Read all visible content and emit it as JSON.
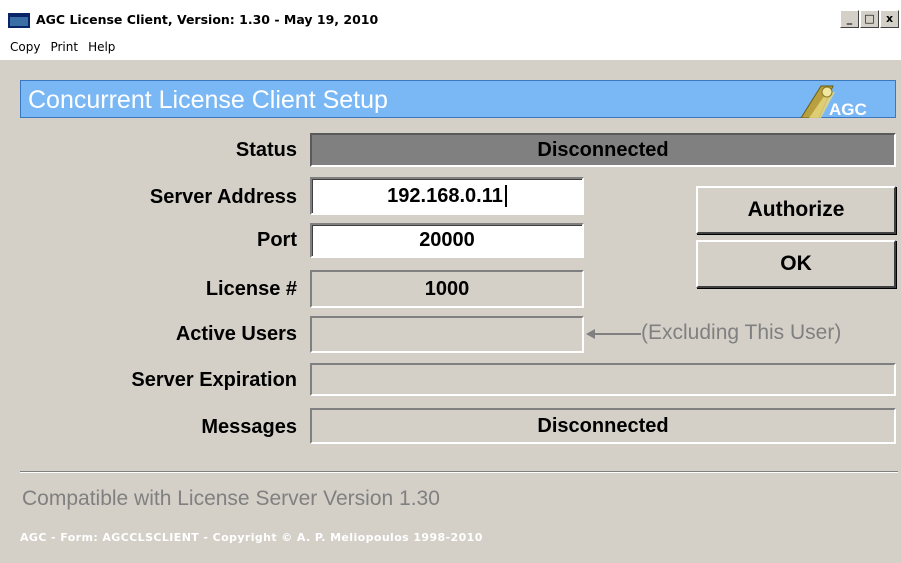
{
  "window": {
    "title": "AGC License Client, Version: 1.30 - May 19, 2010",
    "controls": {
      "minimize": "_",
      "maximize": "□",
      "close": "x"
    }
  },
  "menu": [
    "Copy",
    "Print",
    "Help"
  ],
  "header": {
    "title": "Concurrent License Client Setup",
    "logo_text": "AGC"
  },
  "form": {
    "status_label": "Status",
    "status_value": "Disconnected",
    "server_address_label": "Server Address",
    "server_address_value": "192.168.0.11",
    "port_label": "Port",
    "port_value": "20000",
    "license_label": "License #",
    "license_value": "1000",
    "active_users_label": "Active Users",
    "active_users_value": "",
    "active_users_note": "(Excluding This User)",
    "server_expiration_label": "Server Expiration",
    "server_expiration_value": "",
    "messages_label": "Messages",
    "messages_value": "Disconnected"
  },
  "buttons": {
    "authorize": "Authorize",
    "ok": "OK"
  },
  "compatibility": "Compatible with License Server Version 1.30",
  "footer": "AGC - Form: AGCCLSCLIENT - Copyright © A. P. Meliopoulos 1998-2010",
  "colors": {
    "header_bg": "#7ab8f5",
    "window_bg": "#d4d0c8",
    "status_bg": "#808080"
  },
  "icons": {
    "app": "window-icon",
    "arrow": "left-arrow-icon"
  }
}
